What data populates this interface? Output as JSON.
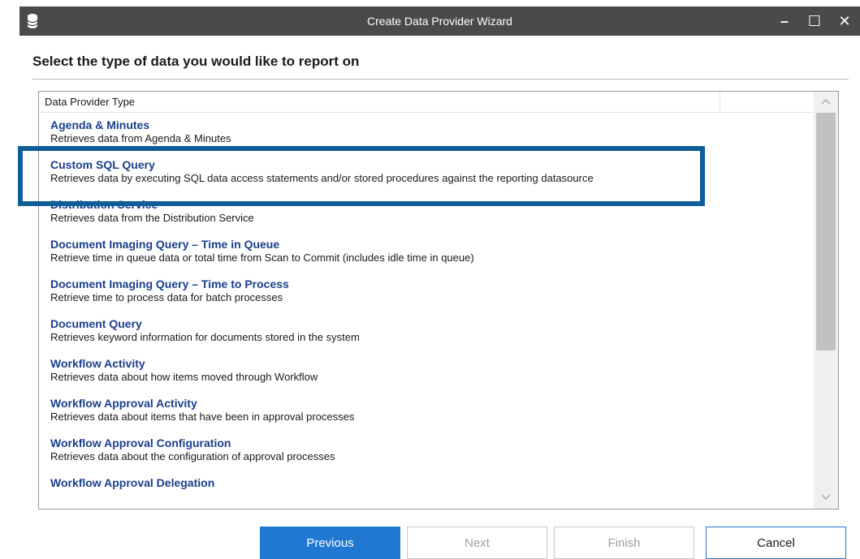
{
  "window": {
    "title": "Create Data Provider Wizard",
    "minimize_glyph": "–",
    "maximize_glyph": "☐",
    "close_glyph": "✕",
    "icon": "database-icon"
  },
  "heading": "Select the type of data you would like to report on",
  "list": {
    "column_header": "Data Provider Type",
    "highlighted_item": "Custom SQL Query",
    "items": [
      {
        "name": "Agenda & Minutes",
        "description": "Retrieves data from Agenda & Minutes"
      },
      {
        "name": "Custom SQL Query",
        "description": "Retrieves data by executing SQL data access statements and/or stored procedures against the reporting datasource"
      },
      {
        "name": "Distribution Service",
        "description": "Retrieves data from the Distribution Service"
      },
      {
        "name": "Document Imaging Query – Time in Queue",
        "description": "Retrieve time in queue data or total time from Scan to Commit (includes idle time in queue)"
      },
      {
        "name": "Document Imaging Query – Time to Process",
        "description": "Retrieve time to process data for batch processes"
      },
      {
        "name": "Document Query",
        "description": "Retrieves keyword information for documents stored in the system"
      },
      {
        "name": "Workflow Activity",
        "description": "Retrieves data about how items moved through Workflow"
      },
      {
        "name": "Workflow Approval Activity",
        "description": "Retrieves data about items that have been in approval processes"
      },
      {
        "name": "Workflow Approval Configuration",
        "description": "Retrieves data about the configuration of approval processes"
      },
      {
        "name": "Workflow Approval Delegation",
        "description": ""
      }
    ]
  },
  "buttons": {
    "previous": "Previous",
    "next": "Next",
    "finish": "Finish",
    "cancel": "Cancel"
  },
  "colors": {
    "title_bar": "#4a4a4a",
    "item_name": "#1a3e8c",
    "highlight_border": "#0d5d99",
    "primary_button": "#1f78d1"
  }
}
